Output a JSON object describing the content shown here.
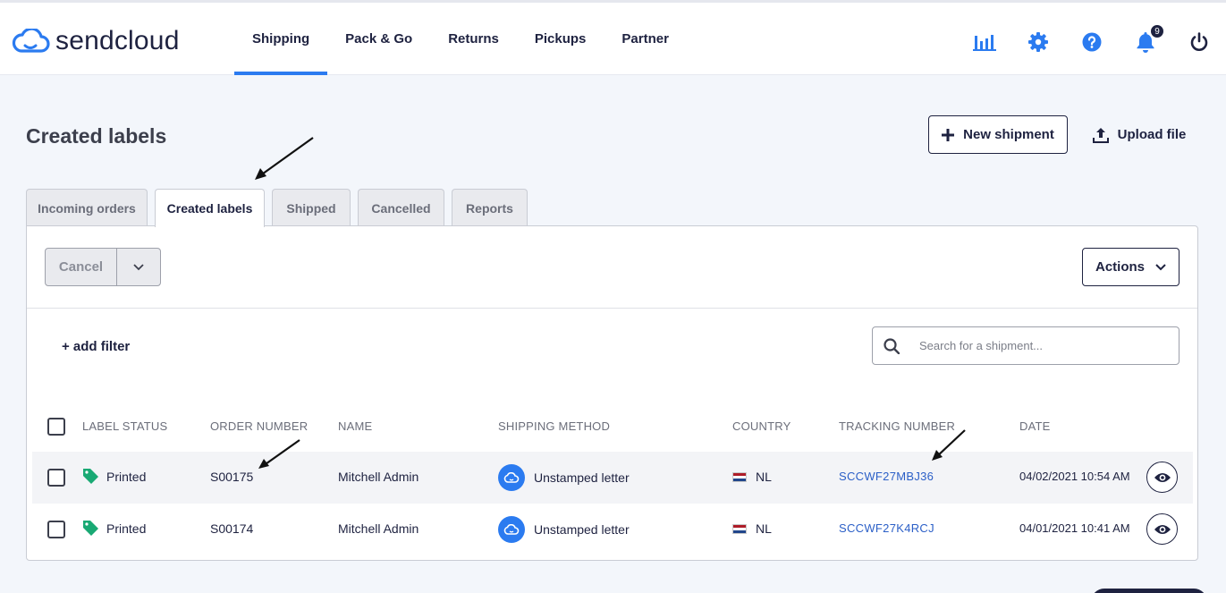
{
  "brand": {
    "name": "sendcloud",
    "accent": "#2b7bf0",
    "navy": "#1e2240"
  },
  "nav": {
    "items": [
      {
        "label": "Shipping",
        "active": true
      },
      {
        "label": "Pack & Go",
        "active": false
      },
      {
        "label": "Returns",
        "active": false
      },
      {
        "label": "Pickups",
        "active": false
      },
      {
        "label": "Partner",
        "active": false
      }
    ],
    "icons": [
      "analytics-icon",
      "gear-icon",
      "help-icon",
      "bell-icon",
      "power-icon"
    ],
    "notification_count": "9"
  },
  "page": {
    "title": "Created labels",
    "new_shipment_label": "New shipment",
    "upload_file_label": "Upload file"
  },
  "tabs": [
    {
      "label": "Incoming orders",
      "active": false
    },
    {
      "label": "Created labels",
      "active": true
    },
    {
      "label": "Shipped",
      "active": false
    },
    {
      "label": "Cancelled",
      "active": false
    },
    {
      "label": "Reports",
      "active": false
    }
  ],
  "toolbar": {
    "cancel_label": "Cancel",
    "actions_label": "Actions",
    "add_filter_label": "+ add filter",
    "search_placeholder": "Search for a shipment..."
  },
  "table": {
    "columns": [
      "LABEL STATUS",
      "ORDER NUMBER",
      "NAME",
      "SHIPPING METHOD",
      "COUNTRY",
      "TRACKING NUMBER",
      "DATE"
    ],
    "rows": [
      {
        "status": "Printed",
        "order": "S00175",
        "name": "Mitchell Admin",
        "method": "Unstamped letter",
        "country": "NL",
        "tracking": "SCCWF27MBJ36",
        "date": "04/02/2021 10:54 AM"
      },
      {
        "status": "Printed",
        "order": "S00174",
        "name": "Mitchell Admin",
        "method": "Unstamped letter",
        "country": "NL",
        "tracking": "SCCWF27K4RCJ",
        "date": "04/01/2021 10:41 AM"
      }
    ]
  }
}
